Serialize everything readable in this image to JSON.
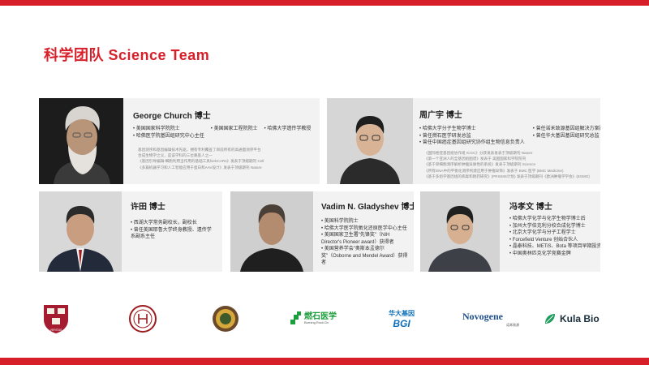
{
  "title": "科学团队 Science Team",
  "cards": {
    "church": {
      "name": "George Church 博士",
      "bullets": [
        "美国国家科学院院士",
        "美国国家工程院院士",
        "哈佛大学遗传学教授",
        "哈佛医学院基因组研究中心主任"
      ],
      "desc": [
        "基因测序和基因编辑技术先驱，拥有专利覆盖了目前所有的高通量测序平台",
        "合成生物学之父，是该学科的三位奠基人之一",
        "《基因引导编辑-细胞利用当作用的基础工具hiebCARs》发表于顶级期刊 Cell",
        "《多篇机器学习和人工智能应用于蛋白和AAV设计》发表于顶级期刊 Nature"
      ]
    },
    "zhou": {
      "name": "周广宇 博士",
      "bullets": [
        "哈佛大学分子生物学博士",
        "曾任诺禾致源基因组解决方案副总裁",
        "曾任燃石医学研发总监",
        "曾任华大基因基因组研究总监",
        "曾任中国癌症基因组研究协作组生物信息负责人"
      ],
      "desc": [
        "《国际癌症基因组协作组 ICGC》分获发表发表于顶级期刊 Nature",
        "《第一个亚洲人的全基因组图谱》发表于 美国国家科学院院刊",
        "《基于单细胞测序解析肿瘤异质性的系统》发表于顶级期刊 Science",
        "《所有DNA中的平衡化测序构建应用于肿瘤早筛》发表于 BMC 医学 (BMC Medicine)",
        "《基于多组学基因组的病毒和耐药研究》(PRISMS计划) 发表于顶级期刊《欧洲肿瘤学学会》(ESMO)"
      ]
    },
    "xu": {
      "name": "许田 博士",
      "bullets": [
        "西湖大学常务副校长，副校长",
        "曾任美国耶鲁大学终身教授、遗传学系副系主任"
      ]
    },
    "gladyshev": {
      "name": "Vadim N. Gladyshev 博士",
      "bullets": [
        "美国科学院院士",
        "哈佛大学医学院氧化还原医学中心主任",
        "美国国家卫生署\"先锋奖\"（NIH Director's Pioneer award）获得者",
        "美国营养学会\"奥斯本孟德尔奖\"（Osborne and Mendel Award）获得者"
      ]
    },
    "feng": {
      "name": "冯孝文 博士",
      "bullets": [
        "哈佛大学化学与化学生物学博士后",
        "加州大学伯克利分校合成化学博士",
        "北京大学化学与分子工程学士",
        "Forcefield Venture 创始合伙人",
        "晶泰科技、METiS、Bota 等项目早期投资人",
        "中国奥林匹克化学竞赛金牌"
      ]
    }
  },
  "logos": {
    "harvard_motto": "VERITAS",
    "burning_rock_cn": "燃石医学",
    "burning_rock_en": "Burning Rock Dx",
    "bgi_cn": "华大基因",
    "bgi_en": "BGI",
    "novogene": "Novogene",
    "novogene_cn": "诺禾致源",
    "kula": "Kula Bio"
  },
  "colors": {
    "accent": "#d71f2a",
    "card_bg": "#f2f2f2",
    "photo_bg": "#d9d9d9"
  }
}
